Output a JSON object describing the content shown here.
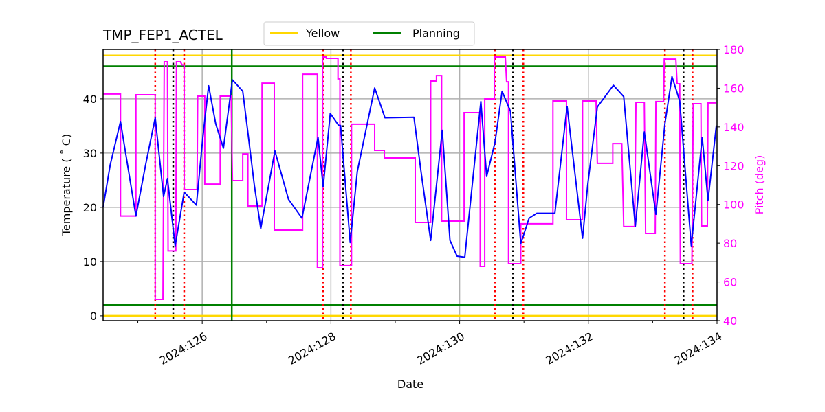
{
  "chart_data": {
    "type": "line",
    "title": "TMP_FEP1_ACTEL",
    "xlabel": "Date",
    "ylabel": "Temperature ($^\\circ$C)",
    "ylabel_display": "Temperature ( ˚ C)",
    "y2label": "Pitch (deg)",
    "xlim": [
      124.46,
      134.0
    ],
    "ylim": [
      -0.9,
      49.1
    ],
    "y2lim": [
      40,
      180
    ],
    "grid": true,
    "x_ticks": [
      126,
      128,
      130,
      132,
      134
    ],
    "x_tick_labels": [
      "2024:126",
      "2024:128",
      "2024:130",
      "2024:132",
      "2024:134"
    ],
    "x_minor_ticks": [
      125,
      127,
      129,
      131,
      133
    ],
    "y_ticks": [
      0,
      10,
      20,
      30,
      40
    ],
    "y_tick_labels": [
      "0",
      "10",
      "20",
      "30",
      "40"
    ],
    "y2_ticks": [
      40,
      60,
      80,
      100,
      120,
      140,
      160,
      180
    ],
    "y2_tick_labels": [
      "40",
      "60",
      "80",
      "100",
      "120",
      "140",
      "160",
      "180"
    ],
    "legend": {
      "placement": "top-center",
      "entries": [
        {
          "label": "Yellow",
          "color": "#ffd700"
        },
        {
          "label": "Planning",
          "color": "#008000"
        }
      ]
    },
    "limits": {
      "yellow": {
        "color": "#ffd700",
        "values": [
          0,
          48
        ]
      },
      "planning": {
        "color": "#008000",
        "values": [
          2,
          46
        ]
      }
    },
    "vlines": {
      "planning_green": {
        "color": "#008000",
        "style": "solid",
        "x": [
          126.46
        ]
      },
      "red_dotted": {
        "color": "#ff0000",
        "style": "dotted",
        "x": [
          125.27,
          125.72,
          127.88,
          128.31,
          130.55,
          130.99,
          133.19,
          133.62
        ]
      },
      "black_dotted": {
        "color": "#000000",
        "style": "dotted",
        "x": [
          125.55,
          128.19,
          130.83,
          133.48
        ]
      }
    },
    "series": [
      {
        "name": "Temperature",
        "axis": "left",
        "color": "#0000ff",
        "x": [
          124.46,
          124.57,
          124.73,
          124.97,
          125.12,
          125.27,
          125.4,
          125.46,
          125.58,
          125.72,
          125.91,
          126.01,
          126.1,
          126.21,
          126.33,
          126.47,
          126.63,
          126.71,
          126.81,
          126.91,
          127.13,
          127.34,
          127.55,
          127.8,
          127.88,
          127.99,
          128.12,
          128.15,
          128.3,
          128.41,
          128.68,
          128.84,
          129.29,
          129.4,
          129.55,
          129.73,
          129.85,
          129.96,
          130.08,
          130.33,
          130.42,
          130.55,
          130.66,
          130.79,
          130.95,
          131.08,
          131.2,
          131.48,
          131.67,
          131.91,
          131.99,
          132.14,
          132.39,
          132.55,
          132.73,
          132.87,
          133.05,
          133.19,
          133.3,
          133.42,
          133.6,
          133.77,
          133.86,
          133.99
        ],
        "y": [
          20.0,
          27.8,
          35.8,
          18.4,
          27.8,
          36.5,
          22.0,
          25.3,
          12.9,
          22.8,
          20.4,
          32.9,
          42.4,
          35.4,
          30.9,
          43.5,
          41.4,
          33.8,
          24.1,
          16.1,
          30.4,
          21.5,
          18.0,
          32.9,
          23.8,
          37.3,
          35.1,
          35.1,
          13.5,
          26.6,
          42.0,
          36.5,
          36.6,
          26.6,
          13.9,
          34.2,
          13.9,
          11.0,
          10.8,
          39.5,
          25.7,
          32.0,
          41.4,
          37.7,
          13.3,
          18.0,
          18.9,
          18.9,
          38.6,
          14.3,
          24.1,
          38.5,
          42.5,
          40.4,
          16.5,
          33.9,
          18.7,
          35.4,
          44.1,
          39.6,
          12.9,
          32.9,
          21.3,
          35.1
        ]
      },
      {
        "name": "Pitch",
        "axis": "right",
        "color": "#ff00ff",
        "x": [
          124.46,
          124.73,
          124.73,
          124.97,
          124.97,
          125.27,
          125.27,
          125.39,
          125.41,
          125.46,
          125.47,
          125.59,
          125.6,
          125.66,
          125.69,
          125.72,
          125.72,
          125.92,
          125.93,
          126.04,
          126.04,
          126.28,
          126.28,
          126.45,
          126.47,
          126.63,
          126.63,
          126.71,
          126.71,
          126.93,
          126.93,
          127.12,
          127.12,
          127.56,
          127.56,
          127.79,
          127.79,
          127.87,
          127.87,
          127.93,
          127.93,
          128.11,
          128.11,
          128.14,
          128.14,
          128.32,
          128.32,
          128.68,
          128.68,
          128.83,
          128.83,
          129.31,
          129.31,
          129.55,
          129.55,
          129.64,
          129.64,
          129.72,
          129.72,
          130.07,
          130.07,
          130.32,
          130.32,
          130.39,
          130.39,
          130.54,
          130.54,
          130.71,
          130.73,
          130.76,
          130.76,
          130.95,
          130.95,
          131.45,
          131.45,
          131.66,
          131.66,
          131.91,
          131.91,
          132.12,
          132.14,
          132.38,
          132.38,
          132.52,
          132.55,
          132.72,
          132.74,
          132.87,
          132.89,
          133.04,
          133.05,
          133.17,
          133.18,
          133.36,
          133.38,
          133.42,
          133.43,
          133.61,
          133.63,
          133.75,
          133.76,
          133.85,
          133.86,
          133.99
        ],
        "y": [
          157.0,
          157.0,
          94.0,
          94.0,
          156.6,
          156.6,
          51.0,
          51.0,
          173.6,
          173.6,
          76.0,
          76.0,
          173.6,
          173.6,
          172.0,
          172.0,
          107.7,
          107.7,
          155.9,
          155.9,
          110.5,
          110.5,
          155.9,
          155.9,
          112.3,
          112.3,
          126.1,
          126.1,
          99.2,
          99.2,
          162.6,
          162.6,
          86.8,
          86.8,
          167.2,
          167.2,
          67.3,
          67.3,
          176.1,
          176.1,
          175.4,
          175.4,
          164.8,
          164.8,
          68.4,
          68.4,
          141.4,
          141.4,
          127.9,
          127.9,
          124.0,
          124.0,
          90.7,
          90.7,
          163.7,
          163.7,
          166.5,
          166.5,
          91.4,
          91.4,
          147.4,
          147.4,
          68.0,
          68.0,
          154.5,
          154.5,
          176.1,
          176.1,
          163.3,
          163.3,
          69.4,
          69.4,
          90.0,
          90.0,
          153.4,
          153.4,
          92.1,
          92.1,
          153.4,
          153.4,
          121.2,
          121.2,
          131.4,
          131.4,
          88.6,
          88.6,
          152.7,
          152.7,
          85.0,
          85.0,
          153.1,
          153.1,
          175.0,
          175.0,
          162.3,
          162.3,
          69.4,
          69.4,
          152.0,
          152.0,
          88.9,
          88.9,
          152.4,
          152.4
        ]
      }
    ]
  }
}
